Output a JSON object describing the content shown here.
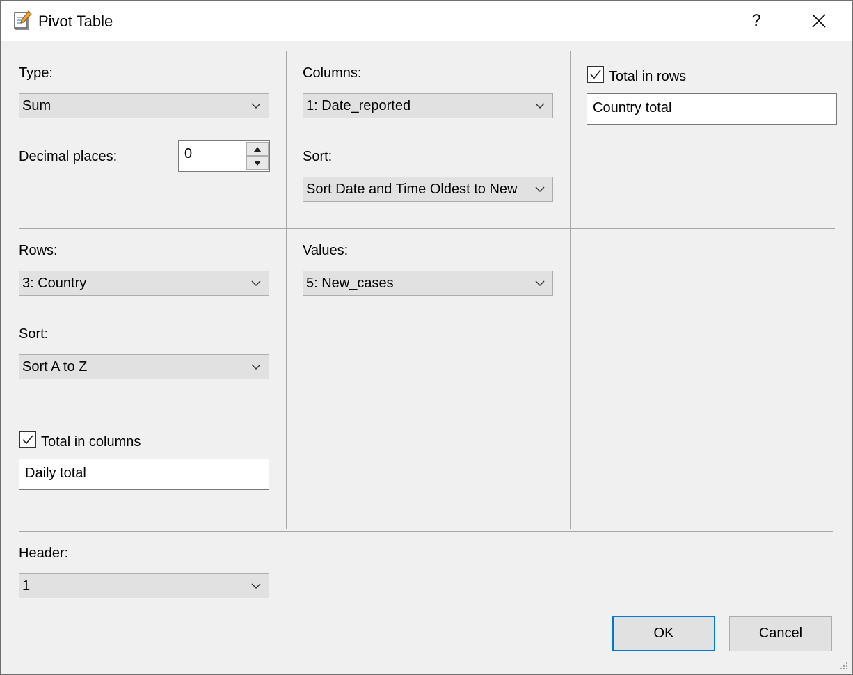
{
  "window": {
    "title": "Pivot Table",
    "help_label": "?",
    "icon": "notepad-icon",
    "close_icon": "close-icon"
  },
  "type": {
    "label": "Type:",
    "value": "Sum"
  },
  "decimal_places": {
    "label": "Decimal places:",
    "value": "0"
  },
  "columns": {
    "label": "Columns:",
    "value": "1: Date_reported",
    "sort_label": "Sort:",
    "sort_value": "Sort Date and Time Oldest to New"
  },
  "total_in_rows": {
    "label": "Total in rows",
    "checked": true,
    "value": "Country total"
  },
  "rows": {
    "label": "Rows:",
    "value": "3: Country",
    "sort_label": "Sort:",
    "sort_value": "Sort A to Z"
  },
  "values": {
    "label": "Values:",
    "value": "5: New_cases"
  },
  "total_in_columns": {
    "label": "Total in columns",
    "checked": true,
    "value": "Daily total"
  },
  "header": {
    "label": "Header:",
    "value": "1"
  },
  "buttons": {
    "ok": "OK",
    "cancel": "Cancel"
  },
  "colors": {
    "dialog_bg": "#f0f0f0",
    "combo_bg": "#e1e1e1",
    "accent": "#0078d7",
    "separator": "#a8a8a8"
  }
}
